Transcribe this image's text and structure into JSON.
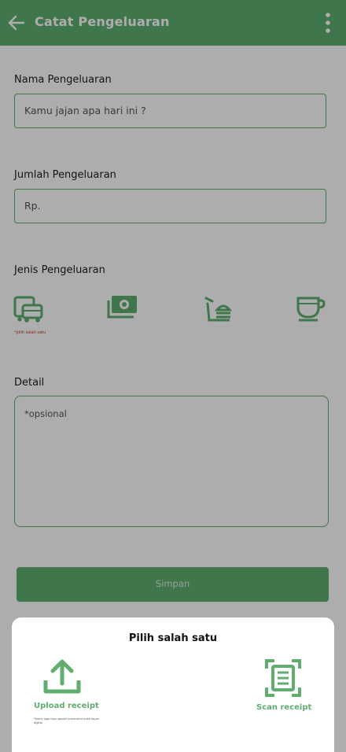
{
  "appbar": {
    "title": "Catat Pengeluaran",
    "back_icon": "arrow-left-icon",
    "menu_icon": "more-vertical-icon"
  },
  "form": {
    "name_label": "Nama Pengeluaran",
    "name_placeholder": "Kamu jajan apa hari ini ?",
    "amount_label": "Jumlah Pengeluaran",
    "amount_placeholder": "Rp.",
    "category_label": "Jenis Pengeluaran",
    "category_hint": "*pilih salah satu",
    "categories": [
      {
        "icon": "transport-icon"
      },
      {
        "icon": "money-icon"
      },
      {
        "icon": "food-icon"
      },
      {
        "icon": "coffee-icon"
      }
    ],
    "detail_label": "Detail",
    "detail_placeholder": "*opsional",
    "save_label": "Simpan"
  },
  "sheet": {
    "title": "Pilih salah satu",
    "upload_label": "Upload receipt",
    "upload_note": "*Kamu juga bisa upload screenshot bukti bayar digital",
    "scan_label": "Scan receipt"
  },
  "colors": {
    "primary": "#5fae6f",
    "hint": "#c0392b"
  }
}
